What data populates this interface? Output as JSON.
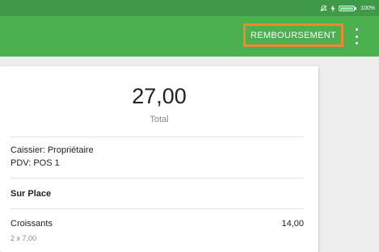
{
  "status_bar": {
    "battery_text": "100%",
    "icons": [
      "notifications-off-icon",
      "charging-icon",
      "battery-icon"
    ]
  },
  "app_bar": {
    "refund_label": "REMBOURSEMENT",
    "menu_icon": "more-vert-icon"
  },
  "receipt": {
    "total_amount": "27,00",
    "total_label": "Total",
    "cashier": "Caissier: Propriétaire",
    "pos": "PDV: POS 1",
    "dining_option": "Sur Place",
    "items": [
      {
        "name": "Croissants",
        "price": "14,00",
        "detail": "2 x 7,00"
      }
    ]
  },
  "colors": {
    "status_bar": "#3f9a47",
    "app_bar": "#4caf50",
    "highlight": "#f0892c",
    "background": "#eeeeee"
  }
}
